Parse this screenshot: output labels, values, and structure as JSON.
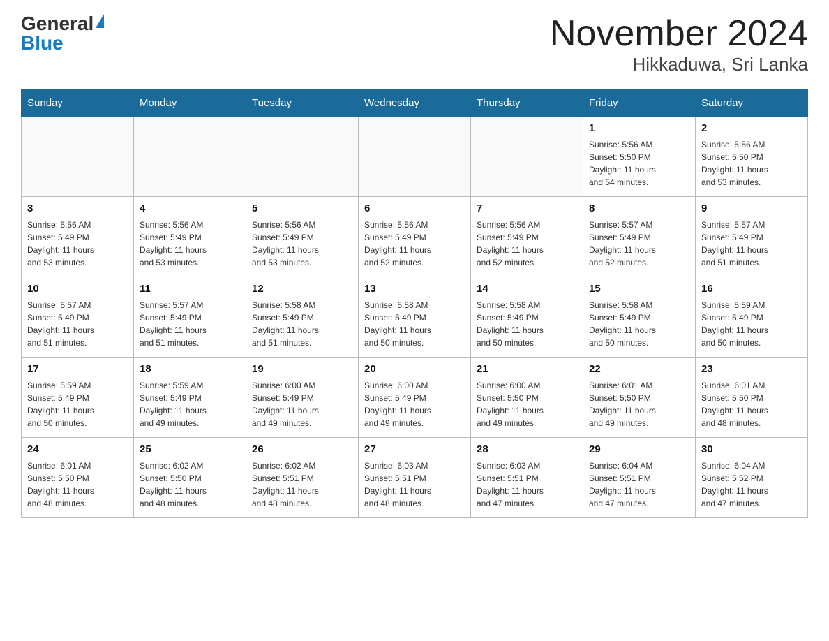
{
  "logo": {
    "general": "General",
    "blue": "Blue"
  },
  "title": {
    "month": "November 2024",
    "location": "Hikkaduwa, Sri Lanka"
  },
  "days_header": [
    "Sunday",
    "Monday",
    "Tuesday",
    "Wednesday",
    "Thursday",
    "Friday",
    "Saturday"
  ],
  "weeks": [
    [
      {
        "day": "",
        "info": ""
      },
      {
        "day": "",
        "info": ""
      },
      {
        "day": "",
        "info": ""
      },
      {
        "day": "",
        "info": ""
      },
      {
        "day": "",
        "info": ""
      },
      {
        "day": "1",
        "info": "Sunrise: 5:56 AM\nSunset: 5:50 PM\nDaylight: 11 hours\nand 54 minutes."
      },
      {
        "day": "2",
        "info": "Sunrise: 5:56 AM\nSunset: 5:50 PM\nDaylight: 11 hours\nand 53 minutes."
      }
    ],
    [
      {
        "day": "3",
        "info": "Sunrise: 5:56 AM\nSunset: 5:49 PM\nDaylight: 11 hours\nand 53 minutes."
      },
      {
        "day": "4",
        "info": "Sunrise: 5:56 AM\nSunset: 5:49 PM\nDaylight: 11 hours\nand 53 minutes."
      },
      {
        "day": "5",
        "info": "Sunrise: 5:56 AM\nSunset: 5:49 PM\nDaylight: 11 hours\nand 53 minutes."
      },
      {
        "day": "6",
        "info": "Sunrise: 5:56 AM\nSunset: 5:49 PM\nDaylight: 11 hours\nand 52 minutes."
      },
      {
        "day": "7",
        "info": "Sunrise: 5:56 AM\nSunset: 5:49 PM\nDaylight: 11 hours\nand 52 minutes."
      },
      {
        "day": "8",
        "info": "Sunrise: 5:57 AM\nSunset: 5:49 PM\nDaylight: 11 hours\nand 52 minutes."
      },
      {
        "day": "9",
        "info": "Sunrise: 5:57 AM\nSunset: 5:49 PM\nDaylight: 11 hours\nand 51 minutes."
      }
    ],
    [
      {
        "day": "10",
        "info": "Sunrise: 5:57 AM\nSunset: 5:49 PM\nDaylight: 11 hours\nand 51 minutes."
      },
      {
        "day": "11",
        "info": "Sunrise: 5:57 AM\nSunset: 5:49 PM\nDaylight: 11 hours\nand 51 minutes."
      },
      {
        "day": "12",
        "info": "Sunrise: 5:58 AM\nSunset: 5:49 PM\nDaylight: 11 hours\nand 51 minutes."
      },
      {
        "day": "13",
        "info": "Sunrise: 5:58 AM\nSunset: 5:49 PM\nDaylight: 11 hours\nand 50 minutes."
      },
      {
        "day": "14",
        "info": "Sunrise: 5:58 AM\nSunset: 5:49 PM\nDaylight: 11 hours\nand 50 minutes."
      },
      {
        "day": "15",
        "info": "Sunrise: 5:58 AM\nSunset: 5:49 PM\nDaylight: 11 hours\nand 50 minutes."
      },
      {
        "day": "16",
        "info": "Sunrise: 5:59 AM\nSunset: 5:49 PM\nDaylight: 11 hours\nand 50 minutes."
      }
    ],
    [
      {
        "day": "17",
        "info": "Sunrise: 5:59 AM\nSunset: 5:49 PM\nDaylight: 11 hours\nand 50 minutes."
      },
      {
        "day": "18",
        "info": "Sunrise: 5:59 AM\nSunset: 5:49 PM\nDaylight: 11 hours\nand 49 minutes."
      },
      {
        "day": "19",
        "info": "Sunrise: 6:00 AM\nSunset: 5:49 PM\nDaylight: 11 hours\nand 49 minutes."
      },
      {
        "day": "20",
        "info": "Sunrise: 6:00 AM\nSunset: 5:49 PM\nDaylight: 11 hours\nand 49 minutes."
      },
      {
        "day": "21",
        "info": "Sunrise: 6:00 AM\nSunset: 5:50 PM\nDaylight: 11 hours\nand 49 minutes."
      },
      {
        "day": "22",
        "info": "Sunrise: 6:01 AM\nSunset: 5:50 PM\nDaylight: 11 hours\nand 49 minutes."
      },
      {
        "day": "23",
        "info": "Sunrise: 6:01 AM\nSunset: 5:50 PM\nDaylight: 11 hours\nand 48 minutes."
      }
    ],
    [
      {
        "day": "24",
        "info": "Sunrise: 6:01 AM\nSunset: 5:50 PM\nDaylight: 11 hours\nand 48 minutes."
      },
      {
        "day": "25",
        "info": "Sunrise: 6:02 AM\nSunset: 5:50 PM\nDaylight: 11 hours\nand 48 minutes."
      },
      {
        "day": "26",
        "info": "Sunrise: 6:02 AM\nSunset: 5:51 PM\nDaylight: 11 hours\nand 48 minutes."
      },
      {
        "day": "27",
        "info": "Sunrise: 6:03 AM\nSunset: 5:51 PM\nDaylight: 11 hours\nand 48 minutes."
      },
      {
        "day": "28",
        "info": "Sunrise: 6:03 AM\nSunset: 5:51 PM\nDaylight: 11 hours\nand 47 minutes."
      },
      {
        "day": "29",
        "info": "Sunrise: 6:04 AM\nSunset: 5:51 PM\nDaylight: 11 hours\nand 47 minutes."
      },
      {
        "day": "30",
        "info": "Sunrise: 6:04 AM\nSunset: 5:52 PM\nDaylight: 11 hours\nand 47 minutes."
      }
    ]
  ]
}
